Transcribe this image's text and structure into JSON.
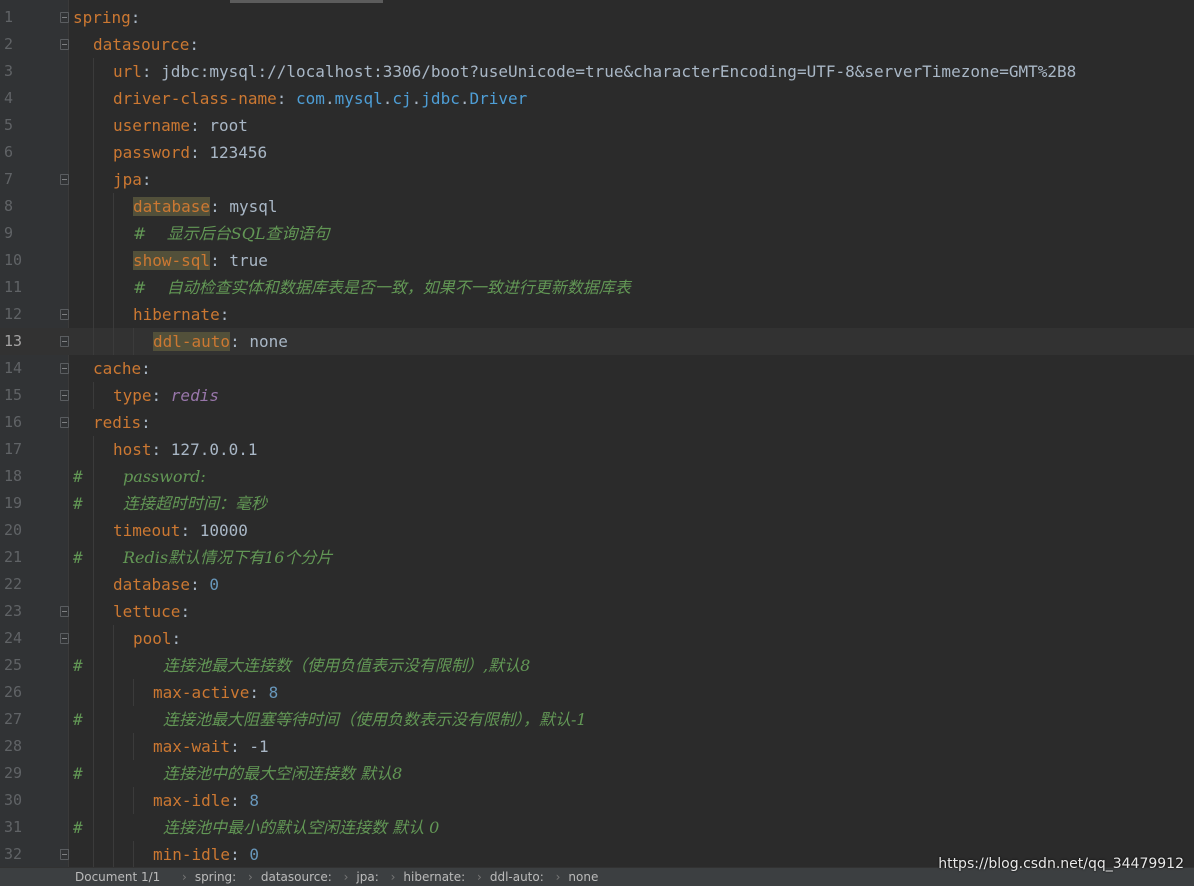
{
  "editor": {
    "current_line": "13",
    "lines": [
      {
        "num": "1",
        "key": "spring",
        "rest": ":"
      },
      {
        "num": "2",
        "key": "datasource",
        "rest": ":"
      },
      {
        "num": "3",
        "key": "url",
        "rest": ": jdbc:mysql://localhost:3306/boot?useUnicode=true&characterEncoding=UTF-8&serverTimezone=GMT%2B8"
      },
      {
        "num": "4",
        "key": "driver-class-name",
        "pkg1": "com",
        "dot1": ".",
        "pkg2": "mysql",
        "dot2": ".",
        "pkg3": "cj",
        "dot3": ".",
        "pkg4": "jdbc",
        "dot4": ".",
        "cls": "Driver"
      },
      {
        "num": "5",
        "key": "username",
        "rest": ": root"
      },
      {
        "num": "6",
        "key": "password",
        "rest": ": 123456"
      },
      {
        "num": "7",
        "key": "jpa",
        "rest": ":"
      },
      {
        "num": "8",
        "key": "database",
        "rest": ": mysql"
      },
      {
        "num": "9",
        "comment": "#    显示后台SQL查询语句"
      },
      {
        "num": "10",
        "key": "show-sql",
        "rest": ": true"
      },
      {
        "num": "11",
        "comment": "#    自动检查实体和数据库表是否一致，如果不一致进行更新数据库表"
      },
      {
        "num": "12",
        "key": "hibernate",
        "rest": ":"
      },
      {
        "num": "13",
        "key": "ddl-auto",
        "rest": ": none"
      },
      {
        "num": "14",
        "key": "cache",
        "rest": ":"
      },
      {
        "num": "15",
        "key": "type",
        "colon": ": ",
        "val": "redis"
      },
      {
        "num": "16",
        "key": "redis",
        "rest": ":"
      },
      {
        "num": "17",
        "key": "host",
        "rest": ": 127.0.0.1"
      },
      {
        "num": "18",
        "hash": "#",
        "comment": "password:"
      },
      {
        "num": "19",
        "hash": "#",
        "comment": "连接超时时间：毫秒"
      },
      {
        "num": "20",
        "key": "timeout",
        "rest": ": 10000"
      },
      {
        "num": "21",
        "hash": "#",
        "comment": "Redis默认情况下有16个分片"
      },
      {
        "num": "22",
        "key": "database",
        "colon": ": ",
        "val": "0"
      },
      {
        "num": "23",
        "key": "lettuce",
        "rest": ":"
      },
      {
        "num": "24",
        "key": "pool",
        "rest": ":"
      },
      {
        "num": "25",
        "hash": "#",
        "comment": "连接池最大连接数（使用负值表示没有限制）,默认8"
      },
      {
        "num": "26",
        "key": "max-active",
        "colon": ": ",
        "val": "8"
      },
      {
        "num": "27",
        "hash": "#",
        "comment": "连接池最大阻塞等待时间（使用负数表示没有限制），默认-1"
      },
      {
        "num": "28",
        "key": "max-wait",
        "rest": ": -1"
      },
      {
        "num": "29",
        "hash": "#",
        "comment": "连接池中的最大空闲连接数 默认8"
      },
      {
        "num": "30",
        "key": "max-idle",
        "colon": ": ",
        "val": "8"
      },
      {
        "num": "31",
        "hash": "#",
        "comment": "连接池中最小的默认空闲连接数 默认 0"
      },
      {
        "num": "32",
        "key": "min-idle",
        "colon": ": ",
        "val": "0"
      }
    ]
  },
  "statusbar": {
    "document": "Document 1/1",
    "breadcrumbs": [
      "spring:",
      "datasource:",
      "jpa:",
      "hibernate:",
      "ddl-auto:",
      "none"
    ],
    "separator": "›"
  },
  "watermark": "https://blog.csdn.net/qq_34479912",
  "colors": {
    "background": "#2b2b2b",
    "gutter": "#313335",
    "key": "#cc7832",
    "number": "#6897bb",
    "comment": "#629755",
    "text": "#a9b7c6"
  }
}
